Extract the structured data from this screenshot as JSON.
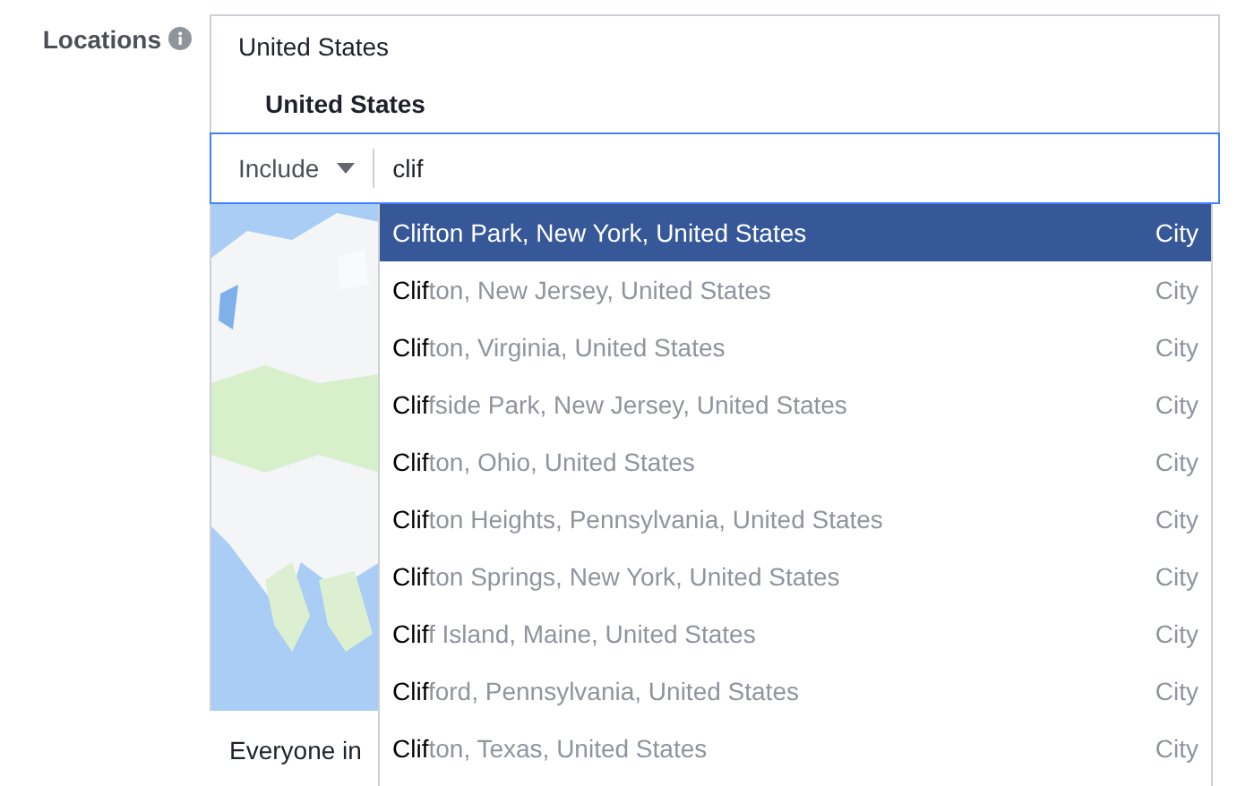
{
  "field_label": "Locations",
  "selected_locations": {
    "group": "United States",
    "item": "United States"
  },
  "search": {
    "mode": "Include",
    "value": "clif"
  },
  "audience_note": "Everyone in",
  "suggestions": [
    {
      "match": "Clif",
      "rest": "ton Park, New York, United States",
      "type": "City",
      "selected": true
    },
    {
      "match": "Clif",
      "rest": "ton, New Jersey, United States",
      "type": "City",
      "selected": false
    },
    {
      "match": "Clif",
      "rest": "ton, Virginia, United States",
      "type": "City",
      "selected": false
    },
    {
      "match": "Clif",
      "rest": "fside Park, New Jersey, United States",
      "type": "City",
      "selected": false
    },
    {
      "match": "Clif",
      "rest": "ton, Ohio, United States",
      "type": "City",
      "selected": false
    },
    {
      "match": "Clif",
      "rest": "ton Heights, Pennsylvania, United States",
      "type": "City",
      "selected": false
    },
    {
      "match": "Clif",
      "rest": "ton Springs, New York, United States",
      "type": "City",
      "selected": false
    },
    {
      "match": "Clif",
      "rest": "f Island, Maine, United States",
      "type": "City",
      "selected": false
    },
    {
      "match": "Clif",
      "rest": "ford, Pennsylvania, United States",
      "type": "City",
      "selected": false
    },
    {
      "match": "Clif",
      "rest": "ton, Texas, United States",
      "type": "City",
      "selected": false
    }
  ]
}
